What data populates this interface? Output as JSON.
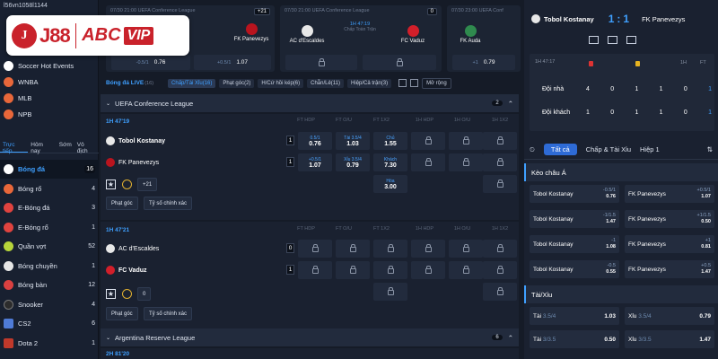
{
  "logo": {
    "brand": "J88",
    "partner": "ABC",
    "partner2": "VIP"
  },
  "sidebar": {
    "user_id": "l56vn1058l1144",
    "top_items": [
      {
        "label": "Soccer Hot Events"
      },
      {
        "label": "WNBA"
      },
      {
        "label": "MLB"
      },
      {
        "label": "NPB"
      }
    ],
    "tabs": [
      "Trực tiếp",
      "Hôm nay",
      "Sớm",
      "Vô địch"
    ],
    "sports": [
      {
        "label": "Bóng đá",
        "count": "16",
        "color": "#ffffff"
      },
      {
        "label": "Bóng rổ",
        "count": "4",
        "color": "#e8673a"
      },
      {
        "label": "E-Bóng đá",
        "count": "3",
        "color": "#e0433f"
      },
      {
        "label": "E-Bóng rổ",
        "count": "1",
        "color": "#e0433f"
      },
      {
        "label": "Quần vợt",
        "count": "52",
        "color": "#b6d43a"
      },
      {
        "label": "Bóng chuyền",
        "count": "1",
        "color": "#e6e6e6"
      },
      {
        "label": "Bóng bàn",
        "count": "12",
        "color": "#d94040"
      },
      {
        "label": "Snooker",
        "count": "4",
        "color": "#2c2c2c"
      },
      {
        "label": "CS2",
        "count": "6",
        "color": "#4f7bd6"
      },
      {
        "label": "Dota 2",
        "count": "1",
        "color": "#c0392b"
      }
    ]
  },
  "topstrip": {
    "cards": [
      {
        "time": "07/30 21:00",
        "league": "UEFA Conference League",
        "badge": "+21",
        "home": "Tobol Kostanay",
        "home_short": "Tobol",
        "away": "FK Panevezys",
        "lines": [
          {
            "label": "-0/0.5",
            "val": "1.25"
          },
          {
            "label": "-0.5/1",
            "val": "0.76"
          },
          {
            "label": "+0.5/1",
            "val": "1.07"
          }
        ]
      },
      {
        "time": "07/30 21:00",
        "league": "UEFA Conference League",
        "badge": "0",
        "home": "AC d'Escaldes",
        "away": "FC Vaduz",
        "live": "1H 47:19",
        "minute": "Chấp Toàn Trận",
        "score": "0 - 0"
      },
      {
        "time": "07/30 23:00",
        "league": "UEFA Conf",
        "badge": "0",
        "home": "FK Auda",
        "away": "",
        "lines": [
          {
            "label": "+1",
            "val": "0.79"
          }
        ]
      }
    ]
  },
  "filters": {
    "live_label": "Bóng đá LIVE",
    "live_count": "(16)",
    "buttons": [
      "Chấp/Tài Xỉu(16)",
      "Phạt góc(2)",
      "H/Cứ hồi kép(6)",
      "Chẵn/Lẻ(11)",
      "Hiệp/Cả trận(3)"
    ],
    "more": "Mở rộng"
  },
  "columns": [
    "FT HDP",
    "FT O/U",
    "FT 1X2",
    "1H HDP",
    "1H O/U",
    "1H 1X2"
  ],
  "leagues": [
    {
      "name": "UEFA Conference League",
      "count": "2",
      "matches": [
        {
          "time": "1H 47'19",
          "home": "Tobol Kostanay",
          "away": "FK Panevezys",
          "home_score": "1",
          "away_score": "1",
          "hdp": [
            {
              "t": "0.5/1",
              "v": "0.76"
            },
            {
              "t": "+0.5/1",
              "v": "1.07"
            }
          ],
          "ou": [
            {
              "t": "Tài 3.5/4",
              "v": "1.03"
            },
            {
              "t": "Xỉu 3.5/4",
              "v": "0.79"
            }
          ],
          "x12": [
            {
              "t": "Chủ",
              "v": "1.55"
            },
            {
              "t": "Khách",
              "v": "7.30"
            },
            {
              "t": "Hòa",
              "v": "3.00"
            }
          ],
          "more": "+21",
          "btn1": "Phạt góc",
          "btn2": "Tỷ số chính xác"
        },
        {
          "time": "1H 47'21",
          "home": "AC d'Escaldes",
          "away": "FC Vaduz",
          "home_score": "0",
          "away_score": "1",
          "more": "0",
          "btn1": "Phạt góc",
          "btn2": "Tỷ số chính xác"
        }
      ]
    },
    {
      "name": "Argentina Reserve League",
      "count": "6",
      "matches": [
        {
          "time": "2H 81'20"
        }
      ]
    }
  ],
  "scoreboard": {
    "home": "Tobol Kostanay",
    "away": "FK Panevezys",
    "home_score": "1",
    "sep": ":",
    "away_score": "1",
    "live_time": "1H 47:17",
    "row_home": "Đội nhà",
    "row_away": "Đội khách",
    "home_vals": [
      "4",
      "0",
      "1",
      "1",
      "0",
      "1"
    ],
    "away_vals": [
      "1",
      "0",
      "1",
      "1",
      "0",
      "1"
    ],
    "col_1h": "1H",
    "col_ft": "FT"
  },
  "right_tabs": [
    "Tất cả",
    "Chấp & Tài Xỉu",
    "Hiệp 1"
  ],
  "handicap": {
    "title": "Kèo châu Á",
    "rows": [
      {
        "home": "Tobol Kostanay",
        "hl": "-0.5/1",
        "hv": "0.76",
        "away": "FK Panevezys",
        "al": "+0.5/1",
        "av": "1.07"
      },
      {
        "home": "Tobol Kostanay",
        "hl": "-1/1.5",
        "hv": "1.47",
        "away": "FK Panevezys",
        "al": "+1/1.5",
        "av": "0.50"
      },
      {
        "home": "Tobol Kostanay",
        "hl": "-1",
        "hv": "1.08",
        "away": "FK Panevezys",
        "al": "+1",
        "av": "0.81"
      },
      {
        "home": "Tobol Kostanay",
        "hl": "-0.5",
        "hv": "0.55",
        "away": "FK Panevezys",
        "al": "+0.5",
        "av": "1.47"
      }
    ]
  },
  "totals": {
    "title": "Tài/Xỉu",
    "rows": [
      {
        "o": "Tài",
        "ol": "3.5/4",
        "ov": "1.03",
        "u": "Xỉu",
        "ul": "3.5/4",
        "uv": "0.79"
      },
      {
        "o": "Tài",
        "ol": "3/3.5",
        "ov": "0.50",
        "u": "Xỉu",
        "ul": "3/3.5",
        "uv": "1.47"
      }
    ]
  }
}
